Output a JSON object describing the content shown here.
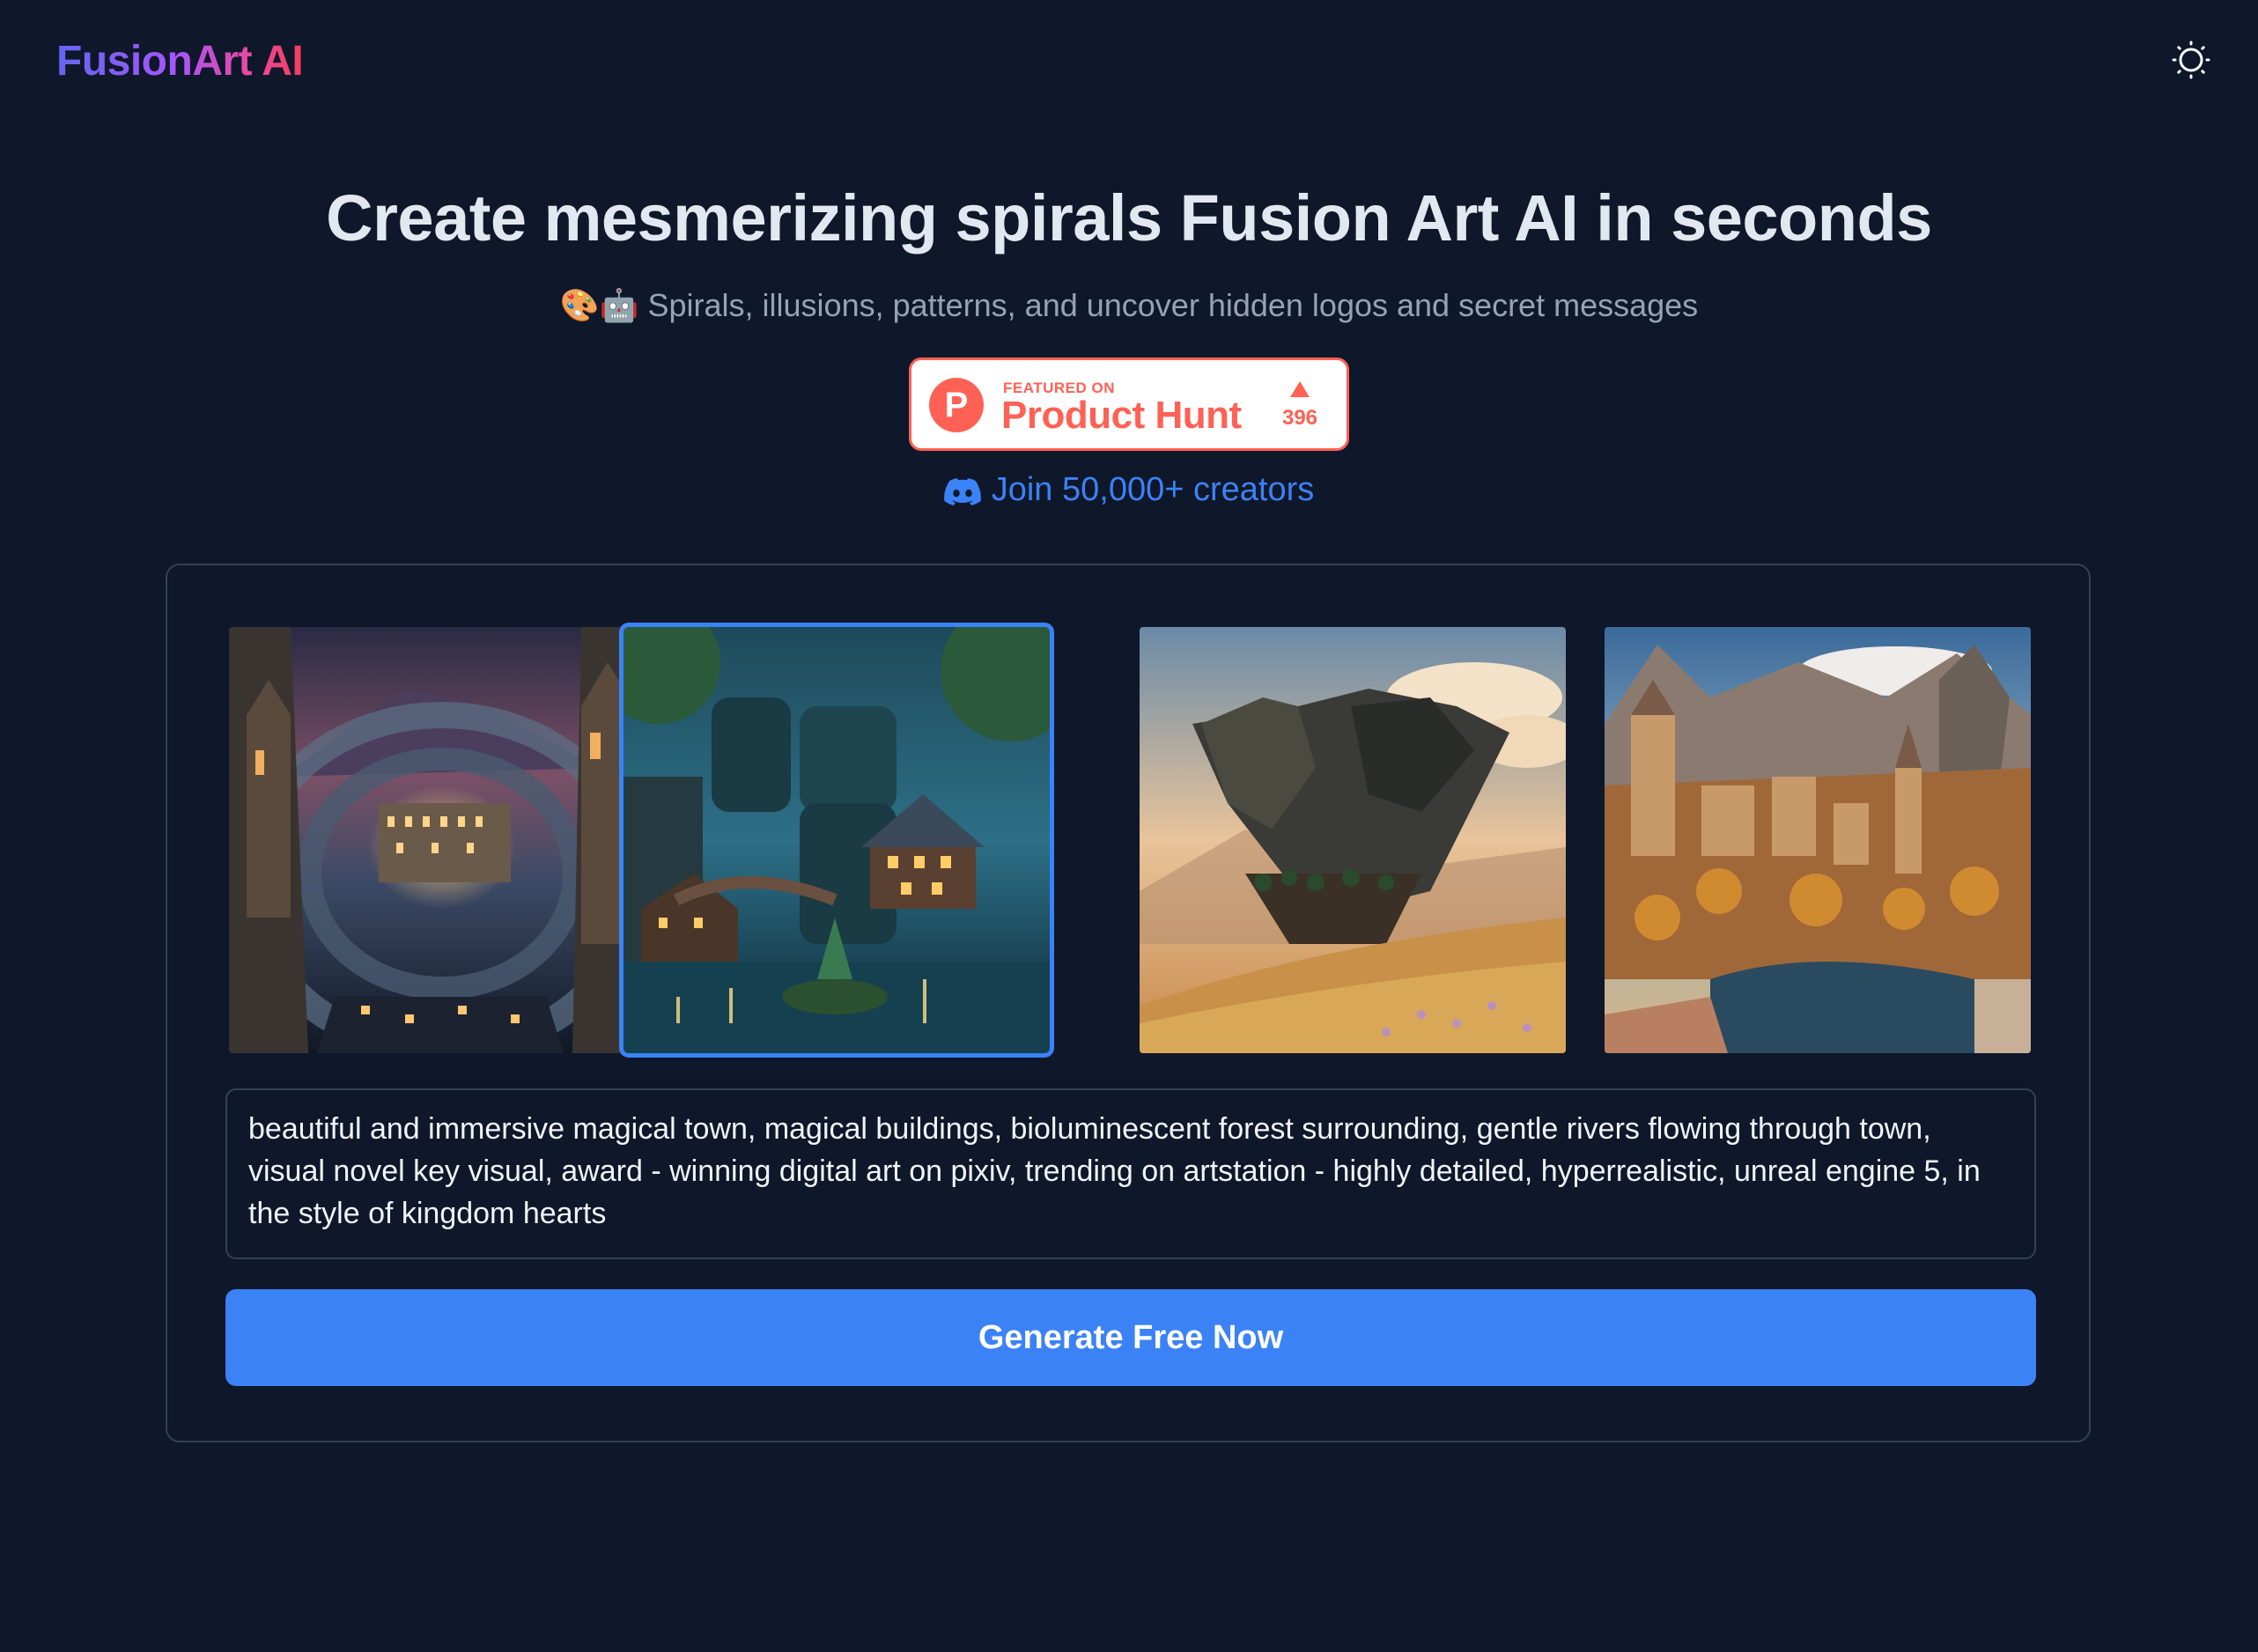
{
  "brand": {
    "name": "FusionArt AI",
    "gradient_colors": [
      "#6366f1",
      "#a855f7",
      "#ec4899",
      "#f43f5e"
    ]
  },
  "header": {
    "theme_toggle_icon": "sun-icon"
  },
  "hero": {
    "title": "Create mesmerizing spirals Fusion Art AI in seconds",
    "subtitle_emoji": "🎨🤖",
    "subtitle": "Spirals, illusions, patterns, and uncover hidden logos and secret messages"
  },
  "product_hunt": {
    "featured_label": "FEATURED ON",
    "name": "Product Hunt",
    "upvotes": "396",
    "accent": "#ff6154"
  },
  "community": {
    "icon": "discord-icon",
    "label": "Join 50,000+ creators"
  },
  "gallery": {
    "selected_index": 1,
    "images": [
      {
        "id": "spiral-castle-town",
        "icon": "image-thumbnail"
      },
      {
        "id": "bioluminescent-forest-town",
        "icon": "image-thumbnail"
      },
      {
        "id": "floating-cliff-meadow",
        "icon": "image-thumbnail"
      },
      {
        "id": "autumn-mountain-village",
        "icon": "image-thumbnail"
      }
    ]
  },
  "prompt": {
    "value": "beautiful and immersive magical town, magical buildings, bioluminescent forest surrounding, gentle rivers flowing through town, visual novel key visual, award - winning digital art on pixiv, trending on artstation - highly detailed, hyperrealistic, unreal engine 5, in the style of kingdom hearts"
  },
  "actions": {
    "generate_label": "Generate Free Now",
    "primary_color": "#3b82f6"
  },
  "colors": {
    "background": "#0f172a",
    "border": "#334155",
    "muted_text": "#94a3b8"
  }
}
